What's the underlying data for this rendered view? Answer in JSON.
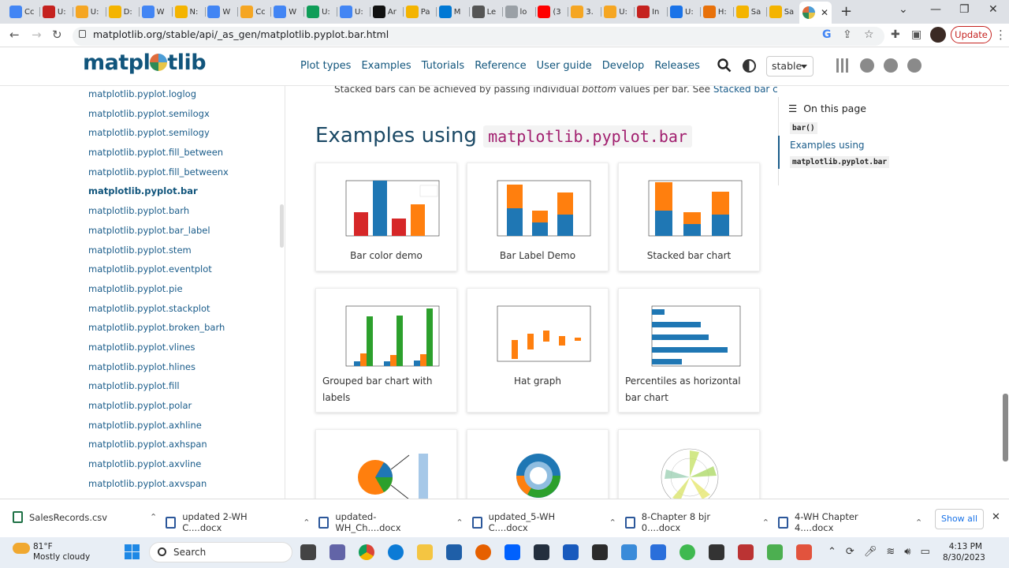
{
  "browser": {
    "tabs": [
      {
        "label": "Cc",
        "color": "#4285f4"
      },
      {
        "label": "U:",
        "color": "#c5221f"
      },
      {
        "label": "U:",
        "color": "#f5a623"
      },
      {
        "label": "D:",
        "color": "#f4b400"
      },
      {
        "label": "W",
        "color": "#4285f4"
      },
      {
        "label": "N:",
        "color": "#f4b400"
      },
      {
        "label": "W",
        "color": "#4285f4"
      },
      {
        "label": "Cc",
        "color": "#f5a623"
      },
      {
        "label": "W",
        "color": "#4285f4"
      },
      {
        "label": "U:",
        "color": "#0f9d58"
      },
      {
        "label": "U:",
        "color": "#4285f4"
      },
      {
        "label": "Ar",
        "color": "#111111"
      },
      {
        "label": "Pa",
        "color": "#f4b400"
      },
      {
        "label": "M",
        "color": "#0078d4"
      },
      {
        "label": "Le",
        "color": "#555555"
      },
      {
        "label": "lo",
        "color": "#9aa0a6"
      },
      {
        "label": "(3",
        "color": "#ff0000"
      },
      {
        "label": "3.",
        "color": "#f5a623"
      },
      {
        "label": "U:",
        "color": "#f5a623"
      },
      {
        "label": "In",
        "color": "#c5221f"
      },
      {
        "label": "U:",
        "color": "#1a73e8"
      },
      {
        "label": "H:",
        "color": "#e8710a"
      },
      {
        "label": "Sa",
        "color": "#f4b400"
      },
      {
        "label": "Sa",
        "color": "#f4b400"
      }
    ],
    "url": "matplotlib.org/stable/api/_as_gen/matplotlib.pyplot.bar.html",
    "update_label": "Update"
  },
  "site": {
    "logo": "matpl",
    "logo_suffix": "tlib",
    "nav": [
      "Plot types",
      "Examples",
      "Tutorials",
      "Reference",
      "User guide",
      "Develop",
      "Releases"
    ],
    "version": "stable"
  },
  "sidebar": {
    "items": [
      "matplotlib.pyplot.loglog",
      "matplotlib.pyplot.semilogx",
      "matplotlib.pyplot.semilogy",
      "matplotlib.pyplot.fill_between",
      "matplotlib.pyplot.fill_betweenx",
      "matplotlib.pyplot.bar",
      "matplotlib.pyplot.barh",
      "matplotlib.pyplot.bar_label",
      "matplotlib.pyplot.stem",
      "matplotlib.pyplot.eventplot",
      "matplotlib.pyplot.pie",
      "matplotlib.pyplot.stackplot",
      "matplotlib.pyplot.broken_barh",
      "matplotlib.pyplot.vlines",
      "matplotlib.pyplot.hlines",
      "matplotlib.pyplot.fill",
      "matplotlib.pyplot.polar",
      "matplotlib.pyplot.axhline",
      "matplotlib.pyplot.axhspan",
      "matplotlib.pyplot.axvline",
      "matplotlib.pyplot.axvspan"
    ],
    "current_index": 5
  },
  "content": {
    "prev_text_before": "Stacked bars can be achieved by passing individual ",
    "prev_text_em": "bottom",
    "prev_text_mid": " values per bar. See ",
    "prev_text_link": "Stacked bar chart",
    "prev_text_end": ".",
    "section_title": "Examples using ",
    "section_code": "matplotlib.pyplot.bar",
    "cards": [
      "Bar color demo",
      "Bar Label Demo",
      "Stacked bar chart",
      "Grouped bar chart with labels",
      "Hat graph",
      "Percentiles as horizontal bar chart",
      "",
      "",
      ""
    ]
  },
  "toc": {
    "heading": "On this page",
    "entry1": "bar()",
    "entry2": "Examples using",
    "entry2_code": "matplotlib.pyplot.bar"
  },
  "downloads": {
    "items": [
      "SalesRecords.csv",
      "updated 2-WH C....docx",
      "updated-WH_Ch....docx",
      "updated_5-WH C....docx",
      "8-Chapter 8 bjr 0....docx",
      "4-WH Chapter 4....docx"
    ],
    "show_all": "Show all"
  },
  "taskbar": {
    "temp": "81°F",
    "weather": "Mostly cloudy",
    "search": "Search",
    "time": "4:13 PM",
    "date": "8/30/2023"
  }
}
